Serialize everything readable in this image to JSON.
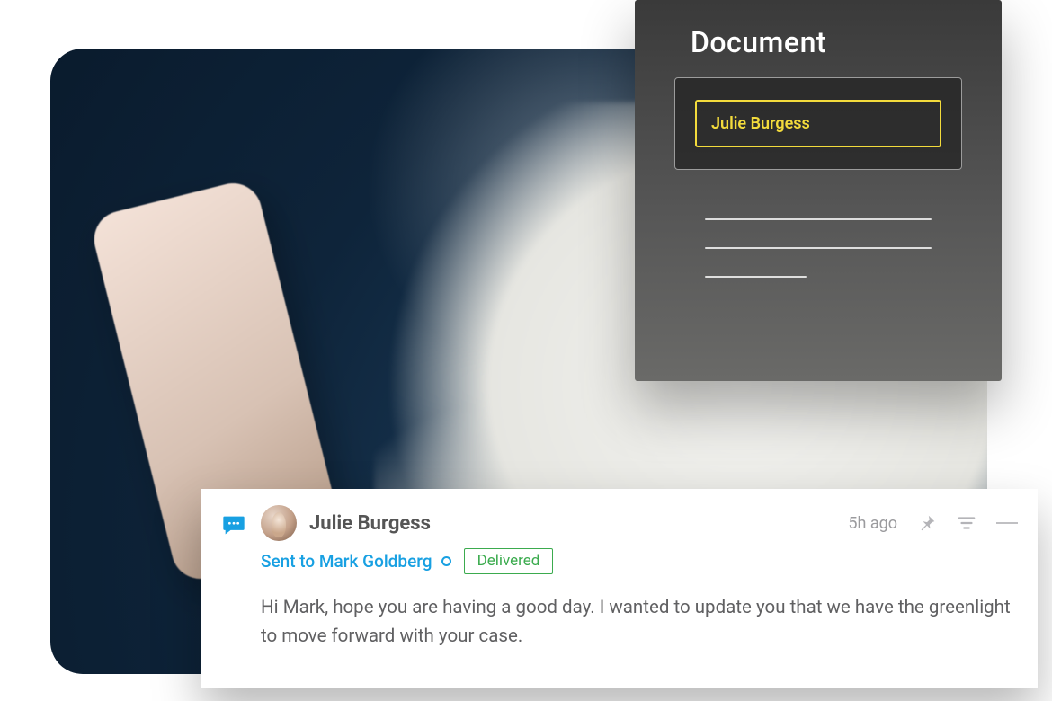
{
  "document_panel": {
    "title": "Document",
    "input_value": "Julie Burgess"
  },
  "message": {
    "sender_name": "Julie Burgess",
    "timestamp": "5h ago",
    "sent_to_label": "Sent to Mark Goldberg",
    "status": "Delivered",
    "body": "Hi Mark, hope you are having a good day. I wanted to update you that we have the greenlight to move forward with your case."
  },
  "icons": {
    "chat": "chat-bubble",
    "pin": "pin",
    "filter": "filter-lines",
    "overflow": "line"
  },
  "colors": {
    "accent_blue": "#18a0e2",
    "accent_green": "#3bab4e",
    "accent_yellow": "#f3db3c"
  }
}
